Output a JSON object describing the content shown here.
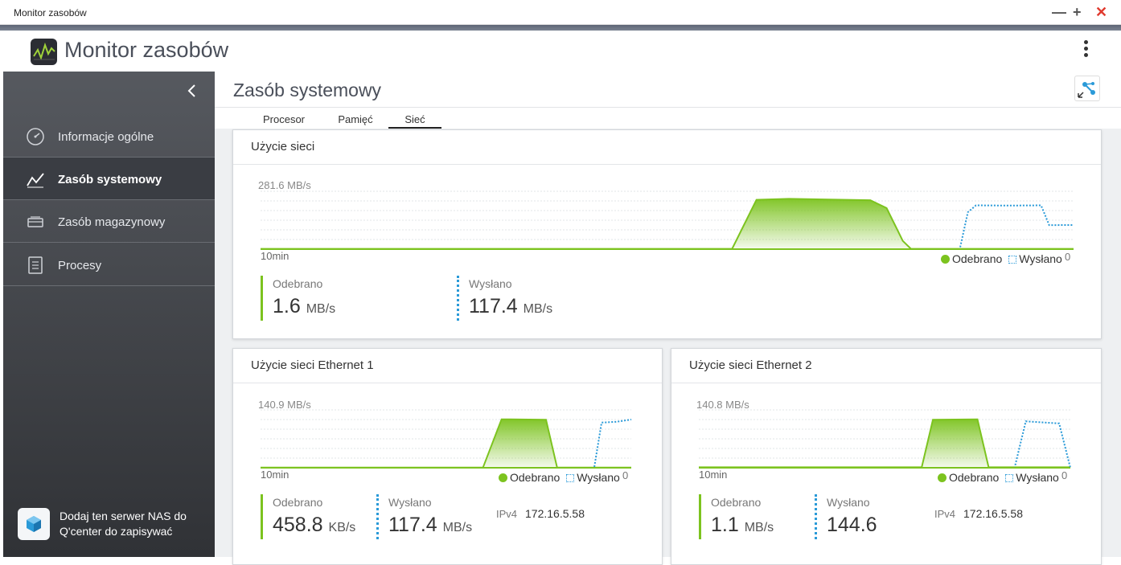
{
  "window": {
    "title": "Monitor zasobów",
    "minimize_icon": "minimize-icon",
    "maximize_icon": "plus-icon",
    "close_icon": "close-x-icon"
  },
  "app": {
    "title": "Monitor zasobów",
    "logo_icon": "monitor-chart-icon",
    "menu_icon": "kebab-menu-icon"
  },
  "sidebar": {
    "collapse_icon": "chevron-left-icon",
    "items": [
      {
        "label": "Informacje ogólne",
        "icon": "speedometer-icon",
        "active": false
      },
      {
        "label": "Zasób systemowy",
        "icon": "line-chart-icon",
        "active": true
      },
      {
        "label": "Zasób magazynowy",
        "icon": "storage-icon",
        "active": false
      },
      {
        "label": "Procesy",
        "icon": "list-icon",
        "active": false
      }
    ],
    "promo": {
      "text": "Dodaj ten serwer NAS do Q'center do zapisywać",
      "icon": "qcenter-cube-icon"
    }
  },
  "main": {
    "title": "Zasób systemowy",
    "topright_icon": "network-link-icon",
    "tabs": [
      {
        "label": "Procesor",
        "active": false
      },
      {
        "label": "Pamięć",
        "active": false
      },
      {
        "label": "Sieć",
        "active": true
      }
    ],
    "cards": {
      "total": {
        "title": "Użycie sieci",
        "ymax": "281.6 MB/s",
        "xlabel": "10min",
        "zero": "0",
        "legend": {
          "received": "Odebrano",
          "sent": "Wysłano"
        },
        "received": {
          "label": "Odebrano",
          "value": "1.6",
          "unit": "MB/s"
        },
        "sent": {
          "label": "Wysłano",
          "value": "117.4",
          "unit": "MB/s"
        }
      },
      "eth1": {
        "title": "Użycie sieci Ethernet 1",
        "ymax": "140.9 MB/s",
        "xlabel": "10min",
        "zero": "0",
        "legend": {
          "received": "Odebrano",
          "sent": "Wysłano"
        },
        "received": {
          "label": "Odebrano",
          "value": "458.8",
          "unit": "KB/s"
        },
        "sent": {
          "label": "Wysłano",
          "value": "117.4",
          "unit": "MB/s"
        },
        "ipv4_label": "IPv4",
        "ipv4": "172.16.5.58"
      },
      "eth2": {
        "title": "Użycie sieci Ethernet 2",
        "ymax": "140.8 MB/s",
        "xlabel": "10min",
        "zero": "0",
        "legend": {
          "received": "Odebrano",
          "sent": "Wysłano"
        },
        "received": {
          "label": "Odebrano",
          "value": "1.1",
          "unit": "MB/s"
        },
        "sent": {
          "label": "Wysłano",
          "value": "144.6",
          "unit": ""
        },
        "ipv4_label": "IPv4",
        "ipv4": "172.16.5.58"
      }
    }
  },
  "colors": {
    "received": "#7cc31f",
    "sent": "#2a9ad8",
    "sidebar_top": "#56595f",
    "sidebar_bottom": "#303236"
  },
  "chart_data": [
    {
      "type": "area",
      "title": "Użycie sieci",
      "xlabel": "10min",
      "ylabel": "",
      "ylim": [
        0,
        281.6
      ],
      "x": [
        0,
        0.5,
        0.58,
        0.61,
        0.65,
        0.75,
        0.77,
        0.78,
        0.79,
        0.8,
        0.86,
        0.87,
        0.88,
        0.92,
        0.96,
        0.97,
        1.0
      ],
      "series": [
        {
          "name": "Odebrano",
          "values": [
            1.6,
            1.6,
            1.6,
            240,
            245,
            238,
            200,
            120,
            40,
            1.6,
            1.6,
            1.6,
            1.6,
            1.6,
            1.6,
            1.6,
            1.6
          ]
        },
        {
          "name": "Wysłano",
          "values": [
            0,
            0,
            0,
            0,
            0,
            0,
            0,
            0,
            0,
            0,
            0,
            180,
            213,
            212,
            213,
            117,
            117.4
          ]
        }
      ]
    },
    {
      "type": "area",
      "title": "Użycie sieci Ethernet 1",
      "xlabel": "10min",
      "ylabel": "",
      "ylim": [
        0,
        140.9
      ],
      "x": [
        0,
        0.6,
        0.65,
        0.77,
        0.8,
        0.9,
        0.92,
        0.96,
        1.0
      ],
      "series": [
        {
          "name": "Odebrano",
          "values": [
            0.45,
            0.45,
            118,
            117,
            0.45,
            0.45,
            0.45,
            0.45,
            0.45
          ]
        },
        {
          "name": "Wysłano",
          "values": [
            0,
            0,
            0,
            0,
            0,
            0,
            110,
            112,
            117.4
          ]
        }
      ]
    },
    {
      "type": "area",
      "title": "Użycie sieci Ethernet 2",
      "xlabel": "10min",
      "ylabel": "",
      "ylim": [
        0,
        140.8
      ],
      "x": [
        0,
        0.6,
        0.63,
        0.75,
        0.78,
        0.85,
        0.88,
        0.97,
        1.0
      ],
      "series": [
        {
          "name": "Odebrano",
          "values": [
            1.1,
            1.1,
            117,
            118,
            1.1,
            1.1,
            1.1,
            1.1,
            1.1
          ]
        },
        {
          "name": "Wysłano",
          "values": [
            0,
            0,
            0,
            0,
            0,
            0,
            113,
            108,
            0
          ]
        }
      ]
    }
  ]
}
